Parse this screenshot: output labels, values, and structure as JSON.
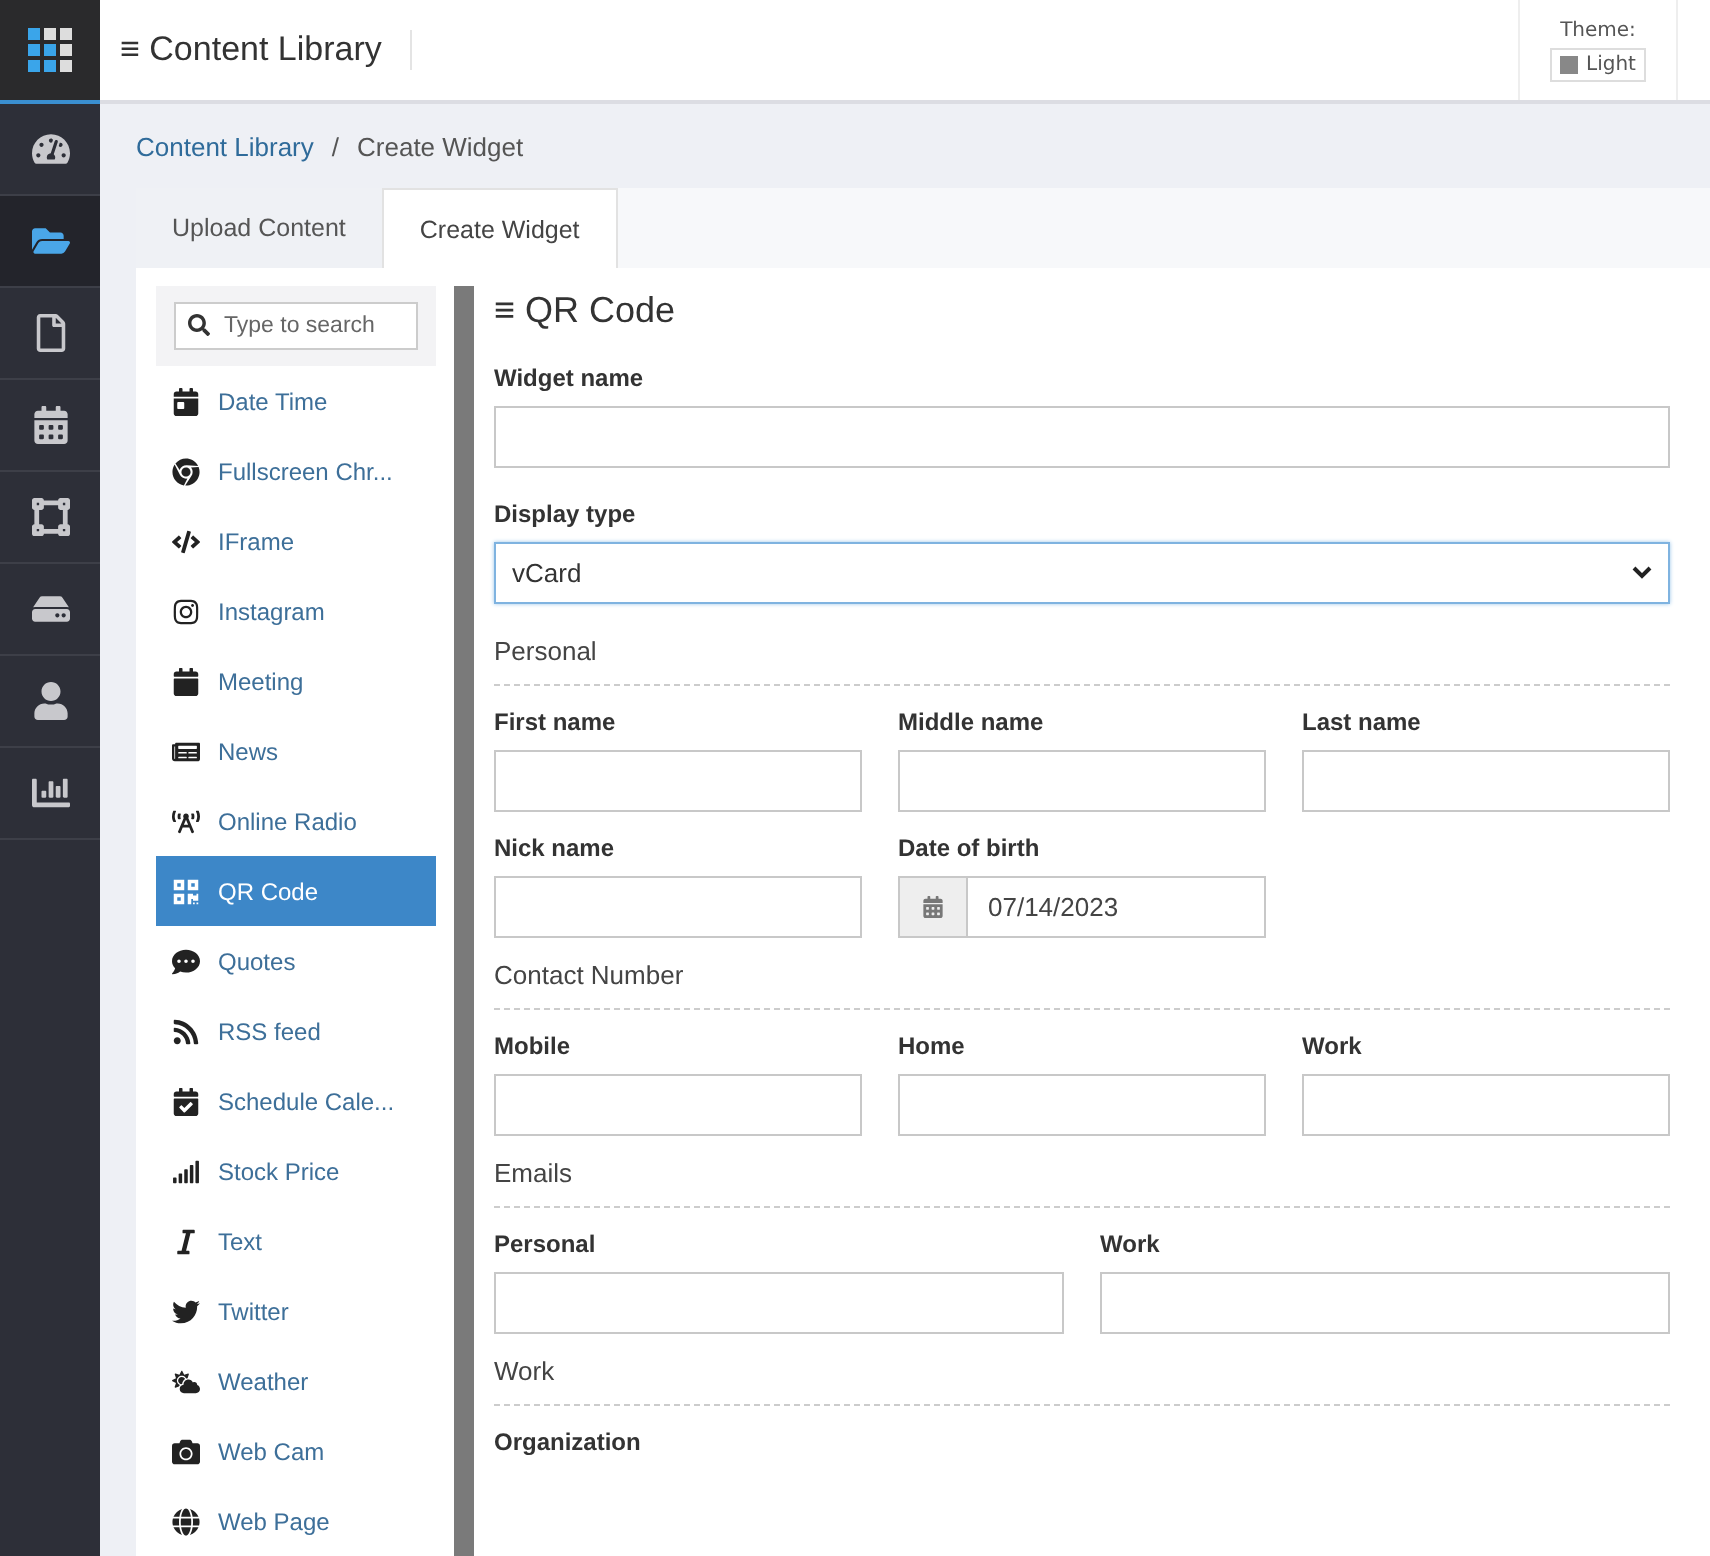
{
  "header": {
    "menu_glyph": "≡",
    "title": "Content Library",
    "theme": {
      "label": "Theme:",
      "value": "Light"
    }
  },
  "nav": [
    {
      "selected": false
    },
    {
      "selected": true
    },
    {
      "selected": false
    },
    {
      "selected": false
    },
    {
      "selected": false
    },
    {
      "selected": false
    },
    {
      "selected": false
    },
    {
      "selected": false
    }
  ],
  "breadcrumb": [
    "Content Library",
    "/",
    "Create Widget"
  ],
  "tabs": [
    {
      "label": "Upload Content",
      "selected": false
    },
    {
      "label": "Create Widget",
      "selected": true
    }
  ],
  "widget_list": {
    "search": {
      "placeholder": "Type to search"
    },
    "items": [
      {
        "label": "Date Time",
        "selected": false
      },
      {
        "label": "Fullscreen Chr...",
        "selected": false
      },
      {
        "label": "IFrame",
        "selected": false
      },
      {
        "label": "Instagram",
        "selected": false
      },
      {
        "label": "Meeting",
        "selected": false
      },
      {
        "label": "News",
        "selected": false
      },
      {
        "label": "Online Radio",
        "selected": false
      },
      {
        "label": "QR Code",
        "selected": true
      },
      {
        "label": "Quotes",
        "selected": false
      },
      {
        "label": "RSS feed",
        "selected": false
      },
      {
        "label": "Schedule Cale...",
        "selected": false
      },
      {
        "label": "Stock Price",
        "selected": false
      },
      {
        "label": "Text",
        "selected": false
      },
      {
        "label": "Twitter",
        "selected": false
      },
      {
        "label": "Weather",
        "selected": false
      },
      {
        "label": "Web Cam",
        "selected": false
      },
      {
        "label": "Web Page",
        "selected": false
      }
    ]
  },
  "form": {
    "menu_glyph": "≡",
    "title": "QR Code",
    "widget_name": {
      "label": "Widget name"
    },
    "display_type": {
      "label": "Display type",
      "value": "vCard"
    },
    "sections": [
      {
        "title": "Personal",
        "rows": [
          [
            {
              "label": "First name",
              "kind": "text"
            },
            {
              "label": "Middle name",
              "kind": "text"
            },
            {
              "label": "Last name",
              "kind": "text"
            }
          ],
          [
            {
              "label": "Nick name",
              "kind": "text"
            },
            {
              "label": "Date of birth",
              "kind": "date",
              "value": "07/14/2023"
            },
            {
              "kind": "empty"
            }
          ]
        ]
      },
      {
        "title": "Contact Number",
        "rows": [
          [
            {
              "label": "Mobile",
              "kind": "text"
            },
            {
              "label": "Home",
              "kind": "text"
            },
            {
              "label": "Work",
              "kind": "text"
            }
          ]
        ]
      },
      {
        "title": "Emails",
        "rows": [
          [
            {
              "label": "Personal",
              "kind": "text"
            },
            {
              "label": "Work",
              "kind": "text"
            }
          ]
        ]
      },
      {
        "title": "Work",
        "rows": [
          [
            {
              "label": "Organization",
              "kind": "label_only"
            }
          ]
        ]
      }
    ]
  }
}
